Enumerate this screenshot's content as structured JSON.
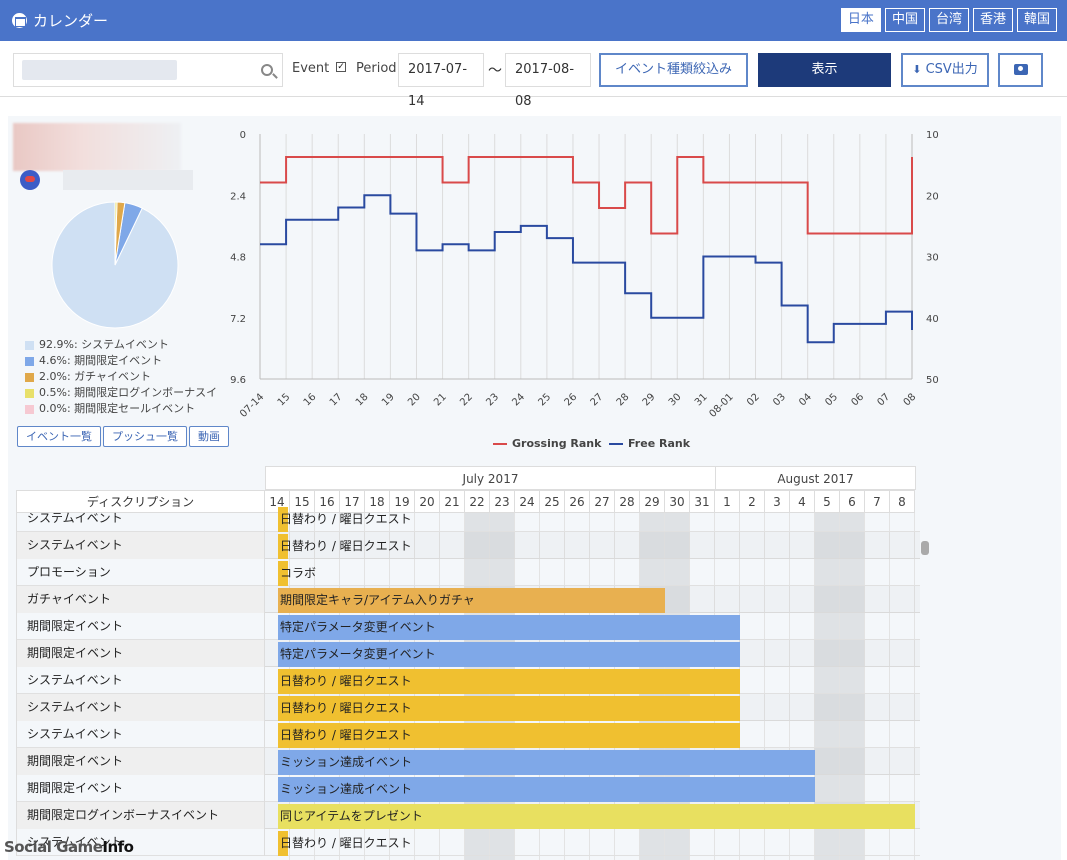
{
  "header": {
    "title": "カレンダー",
    "regions": [
      "日本",
      "中国",
      "台湾",
      "香港",
      "韓国"
    ],
    "active_region": "日本"
  },
  "toolbar": {
    "search_value": "",
    "event_label": "Event",
    "period_label": "Period",
    "date_from": "2017-07-14",
    "tilde": "〜",
    "date_to": "2017-08-08",
    "filter_button": "イベント種類絞込み",
    "show_button": "表示",
    "csv_button": "CSV出力"
  },
  "pie_legend": [
    {
      "label": "92.9%: システムイベント",
      "color": "#cfe0f3"
    },
    {
      "label": "4.6%: 期間限定イベント",
      "color": "#7fa8e8"
    },
    {
      "label": "2.0%: ガチャイベント",
      "color": "#e0a84a"
    },
    {
      "label": "0.5%: 期間限定ログインボーナスイ",
      "color": "#e8e06a"
    },
    {
      "label": "0.0%: 期間限定セールイベント",
      "color": "#f6c9d2"
    }
  ],
  "pie_values": [
    92.9,
    4.6,
    2.0,
    0.5,
    0.0
  ],
  "small_buttons": [
    "イベント一覧",
    "プッシュ一覧",
    "動画"
  ],
  "chart_data": {
    "type": "line",
    "x": [
      "07-14",
      "15",
      "16",
      "17",
      "18",
      "19",
      "20",
      "21",
      "22",
      "23",
      "24",
      "25",
      "26",
      "27",
      "28",
      "29",
      "30",
      "31",
      "08-01",
      "02",
      "03",
      "04",
      "05",
      "06",
      "07",
      "08"
    ],
    "left_yticks": [
      "0",
      "2.4",
      "4.8",
      "7.2",
      "9.6"
    ],
    "right_yticks": [
      "10",
      "20",
      "30",
      "40",
      "50"
    ],
    "series": [
      {
        "name": "Grossing Rank",
        "color": "#d94a4a",
        "axis": "left",
        "values": [
          1.9,
          0.9,
          0.9,
          0.9,
          0.9,
          0.9,
          0.9,
          1.9,
          0.9,
          0.9,
          0.9,
          0.9,
          1.9,
          2.9,
          1.9,
          3.9,
          0.9,
          1.9,
          1.9,
          1.9,
          1.9,
          3.9,
          3.9,
          3.9,
          3.9,
          0.9
        ]
      },
      {
        "name": "Free Rank",
        "color": "#2a4aa0",
        "axis": "right",
        "values": [
          28,
          24,
          24,
          22,
          20,
          23,
          29,
          28,
          29,
          26,
          25,
          27,
          31,
          31,
          36,
          40,
          40,
          30,
          30,
          31,
          38,
          44,
          41,
          41,
          39,
          42
        ]
      }
    ]
  },
  "calendar": {
    "desc_header": "ディスクリプション",
    "months": [
      {
        "label": "July 2017"
      },
      {
        "label": "August 2017"
      }
    ],
    "days": [
      "14",
      "15",
      "16",
      "17",
      "18",
      "19",
      "20",
      "21",
      "22",
      "23",
      "24",
      "25",
      "26",
      "27",
      "28",
      "29",
      "30",
      "31",
      "1",
      "2",
      "3",
      "4",
      "5",
      "6",
      "7",
      "8"
    ],
    "weekend_index": [
      8,
      9,
      15,
      16,
      22,
      23
    ],
    "rows": [
      {
        "desc": "システムイベント",
        "bar": "日替わり / 曜日クエスト",
        "start": 0,
        "span": 1,
        "color": "#f0c030"
      },
      {
        "desc": "システムイベント",
        "bar": "日替わり / 曜日クエスト",
        "start": 0,
        "span": 1,
        "color": "#f0c030"
      },
      {
        "desc": "プロモーション",
        "bar": "コラボ",
        "start": 0,
        "span": 1,
        "color": "#f0c030"
      },
      {
        "desc": "ガチャイベント",
        "bar": "期間限定キャラ/アイテム入りガチャ",
        "start": 0,
        "span": 16,
        "color": "#e8b050"
      },
      {
        "desc": "期間限定イベント",
        "bar": "特定パラメータ変更イベント",
        "start": 0,
        "span": 19,
        "color": "#7fa8e8"
      },
      {
        "desc": "期間限定イベント",
        "bar": "特定パラメータ変更イベント",
        "start": 0,
        "span": 19,
        "color": "#7fa8e8"
      },
      {
        "desc": "システムイベント",
        "bar": "日替わり / 曜日クエスト",
        "start": 0,
        "span": 19,
        "color": "#f0c030"
      },
      {
        "desc": "システムイベント",
        "bar": "日替わり / 曜日クエスト",
        "start": 0,
        "span": 19,
        "color": "#f0c030"
      },
      {
        "desc": "システムイベント",
        "bar": "日替わり / 曜日クエスト",
        "start": 0,
        "span": 19,
        "color": "#f0c030"
      },
      {
        "desc": "期間限定イベント",
        "bar": "ミッション達成イベント",
        "start": 0,
        "span": 22,
        "color": "#7fa8e8"
      },
      {
        "desc": "期間限定イベント",
        "bar": "ミッション達成イベント",
        "start": 0,
        "span": 22,
        "color": "#7fa8e8"
      },
      {
        "desc": "期間限定ログインボーナスイベント",
        "bar": "同じアイテムをプレゼント",
        "start": 0,
        "span": 26,
        "color": "#e8e060"
      },
      {
        "desc": "システムイベント",
        "bar": "日替わり / 曜日クエスト",
        "start": 0,
        "span": 1,
        "color": "#f0c030"
      }
    ]
  },
  "watermark": {
    "text1": "Social Game",
    "text2": "Info"
  }
}
